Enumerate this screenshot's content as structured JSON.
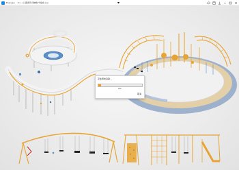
{
  "titlebar": {
    "app_name": "Enscape",
    "document": "D:\\...\\儿童游乐\\滑梯秋千组合.skp",
    "center_marker": "▾",
    "icons": [
      "cloud-icon",
      "window-icon",
      "export-icon",
      "minimize-icon",
      "maximize-icon",
      "close-icon"
    ]
  },
  "dialog": {
    "title": "正在导出渲染...",
    "progress": 0.06,
    "progress_text": "6%",
    "cancel_label": "取消"
  },
  "colors": {
    "accent": "#f0a020",
    "frame_orange": "#e8a433",
    "floor_blue": "#8fa7c8",
    "floor_sand": "#e3cfa8",
    "platform_white": "#f3f3f3"
  }
}
